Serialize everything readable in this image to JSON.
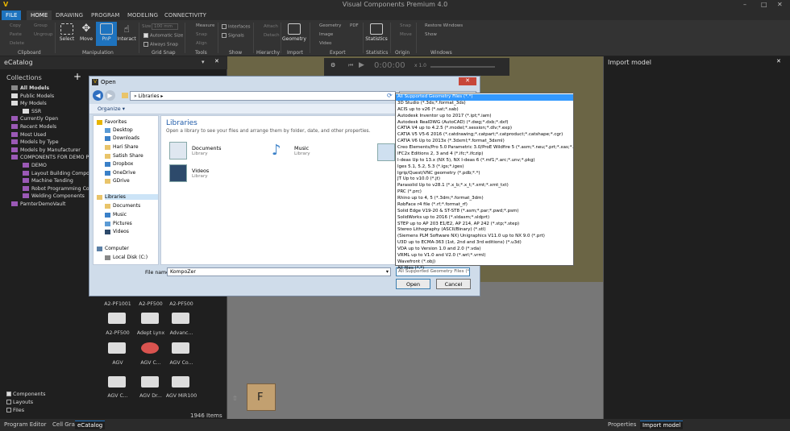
{
  "app": {
    "title": "Visual Components Premium 4.0"
  },
  "ribbon_tabs": [
    "FILE",
    "HOME",
    "DRAWING",
    "PROGRAM",
    "MODELING",
    "CONNECTIVITY"
  ],
  "ribbon": {
    "clipboard": {
      "copy": "Copy",
      "paste": "Paste",
      "delete": "Delete",
      "group": "Group",
      "ungroup": "Ungroup",
      "label": "Clipboard"
    },
    "manipulation": {
      "select": "Select",
      "move": "Move",
      "pnp": "PnP",
      "interact": "Interact",
      "label": "Manipulation"
    },
    "grid_snap": {
      "size_label": "Size",
      "size_value": "100 mm",
      "auto_size": "Automatic Size",
      "always_snap": "Always Snap",
      "label": "Grid Snap"
    },
    "tools": {
      "measure": "Measure",
      "snap": "Snap",
      "align": "Align",
      "label": "Tools"
    },
    "show": {
      "interfaces": "Interfaces",
      "signals": "Signals",
      "label": "Show"
    },
    "hierarchy": {
      "attach": "Attach",
      "detach": "Detach",
      "label": "Hierarchy"
    },
    "import": {
      "geometry": "Geometry",
      "label": "Import"
    },
    "export": {
      "geometry": "Geometry",
      "pdf": "PDF",
      "image": "Image",
      "video": "Video",
      "label": "Export"
    },
    "statistics": {
      "statistics": "Statistics",
      "label": "Statistics"
    },
    "origin": {
      "snap": "Snap",
      "move": "Move",
      "label": "Origin"
    },
    "windows": {
      "restore": "Restore Windows",
      "show": "Show",
      "label": "Windows"
    }
  },
  "left_panel": {
    "title": "eCatalog",
    "collections_label": "Collections",
    "tree": [
      {
        "label": "All Models",
        "bold": true
      },
      {
        "label": "Public Models"
      },
      {
        "label": "My Models"
      },
      {
        "label": "SSR"
      },
      {
        "label": "Currently Open"
      },
      {
        "label": "Recent Models"
      },
      {
        "label": "Most Used"
      },
      {
        "label": "Models by Type"
      },
      {
        "label": "Models by Manufacturer"
      },
      {
        "label": "COMPONENTS FOR DEMO P"
      },
      {
        "label": "DEMO"
      },
      {
        "label": "Layout Building Compone"
      },
      {
        "label": "Machine Tending"
      },
      {
        "label": "Robot Programming Com"
      },
      {
        "label": "Welding Components"
      },
      {
        "label": "ParnterDemoVault"
      }
    ],
    "grid_items": [
      "A2-PF1001",
      "A2-PF500",
      "A2-PF500",
      "A2-PF500",
      "Adept Lynx",
      "Advanc...",
      "AGV",
      "AGV C...",
      "AGV Co...",
      "AGV C...",
      "AGV Dr...",
      "AGV MiR100"
    ],
    "item_count": "1946 Items",
    "filters": [
      {
        "label": "Components",
        "checked": true
      },
      {
        "label": "Layouts",
        "checked": false
      },
      {
        "label": "Files",
        "checked": false
      }
    ]
  },
  "viewport": {
    "time": "0:00:00",
    "speed": "x 1.0",
    "view_cube_label": "F"
  },
  "right_panel": {
    "title": "Import model"
  },
  "bottom_tabs_left": [
    "Program Editor",
    "Cell Graph",
    "eCatalog"
  ],
  "bottom_tabs_right": [
    "Properties",
    "Import model"
  ],
  "dialog": {
    "title": "Open",
    "address": "Libraries",
    "organize": "Organize",
    "nav": [
      {
        "label": "Favorites",
        "group": true
      },
      {
        "label": "Desktop"
      },
      {
        "label": "Downloads"
      },
      {
        "label": "Hari Share"
      },
      {
        "label": "Satish Share"
      },
      {
        "label": "Dropbox"
      },
      {
        "label": "OneDrive"
      },
      {
        "label": "GDrive"
      },
      {
        "label": "Libraries",
        "group": true
      },
      {
        "label": "Documents"
      },
      {
        "label": "Music"
      },
      {
        "label": "Pictures"
      },
      {
        "label": "Videos"
      },
      {
        "label": "Computer",
        "group": true
      },
      {
        "label": "Local Disk (C:)"
      }
    ],
    "main_title": "Libraries",
    "main_subtitle": "Open a library to see your files and arrange them by folder, date, and other properties.",
    "libraries": [
      {
        "name": "Documents",
        "type": "Library"
      },
      {
        "name": "Music",
        "type": "Library"
      },
      {
        "name": "Videos",
        "type": "Library"
      }
    ],
    "filename_label": "File name:",
    "filename_value": "KompoZer",
    "filetype_value": "All Supported Geometry Files (*.*)",
    "open_label": "Open",
    "cancel_label": "Cancel",
    "filetypes": [
      "All Supported Geometry Files (*.*)",
      "3D Studio (*.3ds;*.format_3ds)",
      "ACIS up to v26 (*.sat;*.sab)",
      "Autodesk Inventor up to 2017 (*.ipt;*.iam)",
      "Autodesk RealDWG (AutoCAD) (*.dwg;*.dxb;*.dxf)",
      "CATIA V4 up to 4.2.5 (*.model;*.session;*.dlv;*.exp)",
      "CATIA V5 V5-6 2016 (*.catdrawing;*.catpart;*.catproduct;*.catshape;*.cgr)",
      "CATIA V6 Up to 2013x (*.3dxml;*.format_3dxml)",
      "Creo Elements/Pro 5.0 Parametric 3.0/ProE Wildfire 5 (*.asm;*.neu;*.prt;*.xas;*.xpr)",
      "IFC2x Editions 2, 3 and 4 (*.ifc;*.ifczip)",
      "I-deas Up to 13.x (NX 5), NX I-deas 6 (*.mf1;*.arc;*.unv;*.pkg)",
      "Iges 5.1, 5.2, 5.3 (*.igs;*.iges)",
      "Igrip/Quest/VNC geometry (*.pdb;*.*)",
      "JT Up to v10.0 (*.jt)",
      "Parasolid Up to v28.1 (*.x_b;*.x_t;*.xmt;*.xmt_txt)",
      "PRC (*.prc)",
      "Rhino up to 4, 5 (*.3dm;*.format_3dm)",
      "RobFace r4 file (*.rf;*.format_rf)",
      "Solid Edge V19-20 & ST-ST8 (*.asm;*.par;*.pwd;*.psm)",
      "SolidWorks up to 2016 (*.sldasm;*.sldprt)",
      "STEP up to AP 203 E1/E2, AP 214, AP 242 (*.stp;*.step)",
      "Stereo Lithography (ASCII/Binary) (*.stl)",
      "(Siemens PLM Software NX) Unigraphics V11.0 up to NX 9.0 (*.prt)",
      "U3D up to ECMA-363 (1st, 2nd and 3rd editions) (*.u3d)",
      "VDA up to Version 1.0 and 2.0 (*.vda)",
      "VRML up to V1.0 and V2.0 (*.wrl;*.vrml)",
      "Wavefront (*.obj)",
      "All files (*.*)"
    ]
  },
  "colors": {
    "accent": "#1e73be",
    "selection": "#3399ff",
    "viewport_backdrop": "#6b6545"
  }
}
